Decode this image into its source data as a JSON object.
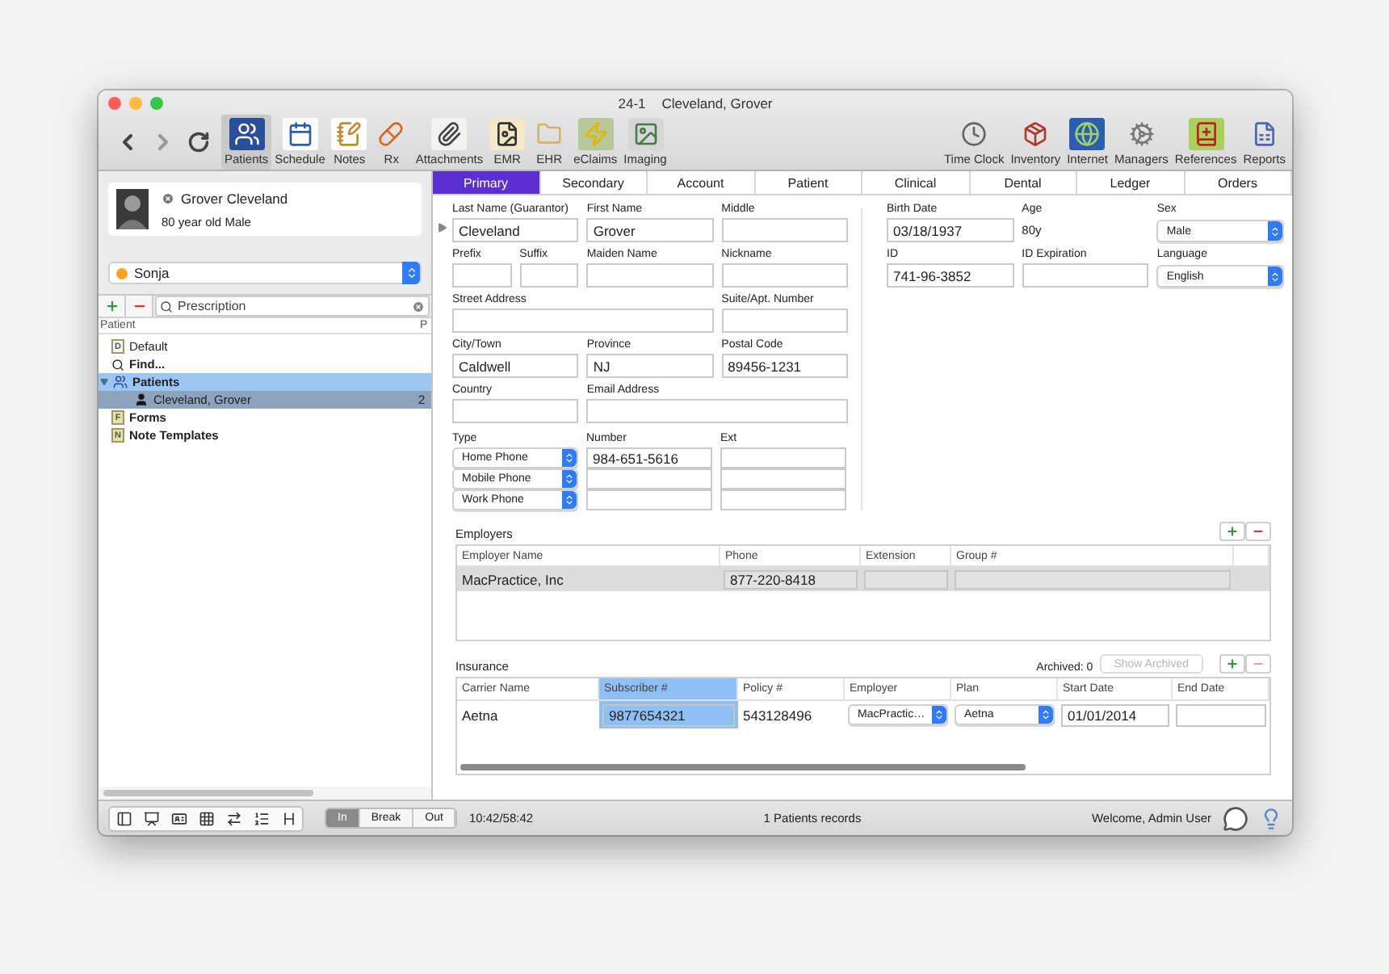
{
  "window": {
    "title_code": "24-1",
    "title_name": "Cleveland, Grover"
  },
  "toolbar": {
    "left": [
      {
        "label": "Patients",
        "selected": true
      },
      {
        "label": "Schedule",
        "selected": false
      },
      {
        "label": "Notes",
        "selected": false
      },
      {
        "label": "Rx",
        "selected": false
      },
      {
        "label": "Attachments",
        "selected": false
      },
      {
        "label": "EMR",
        "selected": false
      },
      {
        "label": "EHR",
        "selected": false
      },
      {
        "label": "eClaims",
        "selected": false
      },
      {
        "label": "Imaging",
        "selected": false
      }
    ],
    "right": [
      {
        "label": "Time Clock",
        "selected": false
      },
      {
        "label": "Inventory",
        "selected": false
      },
      {
        "label": "Internet",
        "selected": false
      },
      {
        "label": "Managers",
        "selected": false
      },
      {
        "label": "References",
        "selected": false
      },
      {
        "label": "Reports",
        "selected": false
      }
    ]
  },
  "sidebar": {
    "patient_card": {
      "name": "Grover Cleveland",
      "subtitle": "80 year old Male"
    },
    "provider": {
      "name": "Sonja",
      "color": "#f5a623"
    },
    "search": {
      "value": "Prescription"
    },
    "columns": [
      "Patient",
      "P"
    ],
    "tree": [
      {
        "kind": "document",
        "badge": "D",
        "label": "Default",
        "highlighted": false,
        "selected": false
      },
      {
        "kind": "search",
        "label": "Find...",
        "highlighted": false,
        "selected": false
      },
      {
        "kind": "group",
        "label": "Patients",
        "expanded": true,
        "highlighted": true,
        "selected": false,
        "children": [
          {
            "kind": "patient",
            "label": "Cleveland, Grover",
            "extra": "2",
            "selected": true
          }
        ]
      },
      {
        "kind": "folder",
        "badge": "F",
        "label": "Forms",
        "highlighted": false,
        "selected": false
      },
      {
        "kind": "folder",
        "badge": "N",
        "label": "Note Templates",
        "highlighted": false,
        "selected": false
      }
    ]
  },
  "tabs": [
    {
      "label": "Primary",
      "selected": true
    },
    {
      "label": "Secondary",
      "selected": false
    },
    {
      "label": "Account",
      "selected": false
    },
    {
      "label": "Patient",
      "selected": false
    },
    {
      "label": "Clinical",
      "selected": false
    },
    {
      "label": "Dental",
      "selected": false
    },
    {
      "label": "Ledger",
      "selected": false
    },
    {
      "label": "Orders",
      "selected": false
    }
  ],
  "form": {
    "left_rows": [
      [
        {
          "label": "Last Name (Guarantor)",
          "value": "Cleveland",
          "kind": "text",
          "marker": true
        },
        {
          "label": "First Name",
          "value": "Grover",
          "kind": "text"
        },
        {
          "label": "Middle",
          "kind": "text"
        }
      ],
      [
        {
          "label": "Prefix",
          "kind": "half"
        },
        {
          "label": "Suffix",
          "kind": "half"
        },
        {
          "label": "Maiden Name",
          "kind": "text"
        },
        {
          "label": "Nickname",
          "kind": "text"
        }
      ],
      [
        {
          "label": "Street Address",
          "kind": "wide"
        },
        {
          "label": "Suite/Apt. Number",
          "kind": "text"
        }
      ],
      [
        {
          "label": "City/Town",
          "value": "Caldwell",
          "kind": "text"
        },
        {
          "label": "Province",
          "value": "NJ",
          "kind": "text"
        },
        {
          "label": "Postal Code",
          "value": "89456-1231",
          "kind": "text"
        }
      ],
      [
        {
          "label": "Country",
          "kind": "text"
        },
        {
          "label": "Email Address",
          "kind": "wide"
        }
      ]
    ],
    "right_rows": [
      [
        {
          "label": "Birth Date",
          "value": "03/18/1937",
          "kind": "text"
        },
        {
          "label": "Age",
          "value": "80y",
          "kind": "static"
        },
        {
          "label": "Sex",
          "value": "Male",
          "kind": "select"
        }
      ],
      [
        {
          "label": "ID",
          "value": "741-96-3852",
          "kind": "text"
        },
        {
          "label": "ID Expiration",
          "kind": "text"
        },
        {
          "label": "Language",
          "value": "English",
          "kind": "select"
        }
      ]
    ],
    "phones": {
      "headers": [
        "Type",
        "Number",
        "Ext"
      ],
      "rows": [
        {
          "type": "Home Phone",
          "number": "984-651-5616"
        },
        {
          "type": "Mobile Phone"
        },
        {
          "type": "Work Phone"
        }
      ]
    }
  },
  "employers": {
    "title": "Employers",
    "add_disabled": false,
    "remove_disabled": false,
    "columns": [
      "Employer Name",
      "Phone",
      "Extension",
      "Group #"
    ],
    "rows": [
      {
        "name": "MacPractice, Inc",
        "phone": "877-220-8418",
        "selected": true
      }
    ]
  },
  "insurance": {
    "title": "Insurance",
    "archived": "Archived: 0",
    "show_archived": {
      "label": "Show Archived",
      "disabled": true
    },
    "add_disabled": false,
    "remove_disabled": true,
    "columns": [
      {
        "label": "Carrier Name",
        "selected": false
      },
      {
        "label": "Subscriber #",
        "selected": true
      },
      {
        "label": "Policy #",
        "selected": false
      },
      {
        "label": "Employer",
        "selected": false
      },
      {
        "label": "Plan",
        "selected": false
      },
      {
        "label": "Start Date",
        "selected": false
      },
      {
        "label": "End Date",
        "selected": false
      }
    ],
    "rows": [
      {
        "cells": [
          {
            "kind": "plain",
            "value": "Aetna"
          },
          {
            "kind": "field",
            "value": "9877654321"
          },
          {
            "kind": "plain",
            "value": "543128496"
          },
          {
            "kind": "select",
            "value": "MacPractic…"
          },
          {
            "kind": "select",
            "value": "Aetna"
          },
          {
            "kind": "field",
            "value": "01/01/2014"
          },
          {
            "kind": "field"
          }
        ]
      }
    ]
  },
  "status_bar": {
    "clock": [
      {
        "label": "In",
        "selected": true
      },
      {
        "label": "Break",
        "selected": false
      },
      {
        "label": "Out",
        "selected": false
      }
    ],
    "time": "10:42/58:42",
    "records": "1 Patients records",
    "welcome": "Welcome, Admin User"
  }
}
